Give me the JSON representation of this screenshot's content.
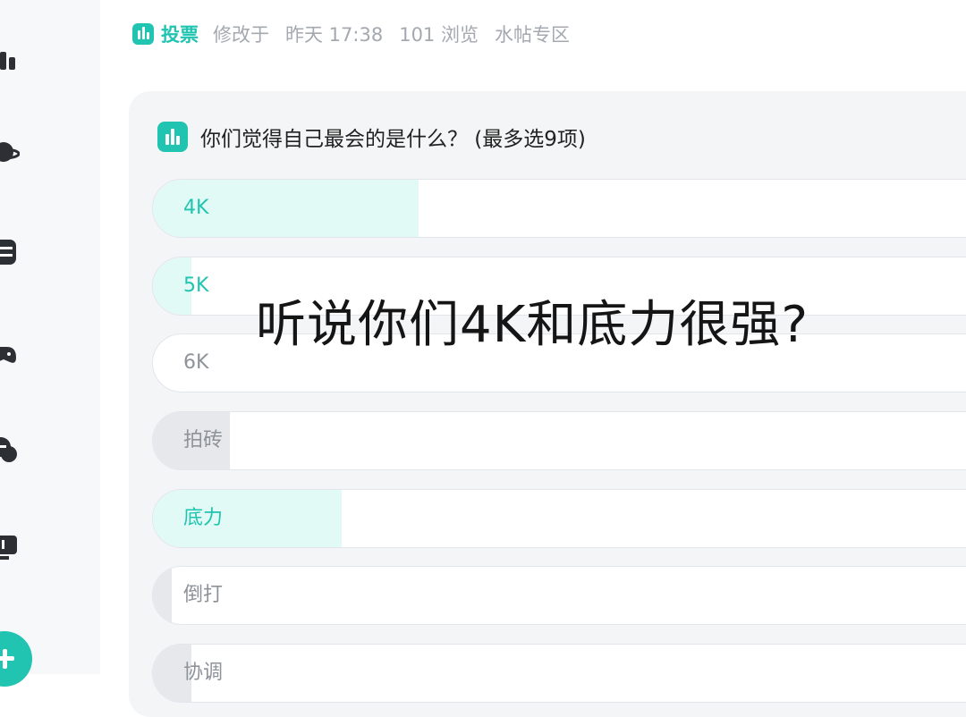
{
  "meta": {
    "tag_label": "投票",
    "modified": "修改于",
    "time": "昨天 17:38",
    "views": "101 浏览",
    "section": "水帖专区"
  },
  "poll": {
    "question": "你们觉得自己最会的是什么？ (最多选9项)",
    "options": [
      {
        "label": "4K",
        "fill_fraction": 0.31,
        "style": "teal",
        "fill_color": "#e1faf6"
      },
      {
        "label": "5K",
        "fill_fraction": 0.045,
        "style": "teal",
        "fill_color": "#e1faf6"
      },
      {
        "label": "6K",
        "fill_fraction": 0.0,
        "style": "gray",
        "fill_color": "#e6e8ec"
      },
      {
        "label": "拍砖",
        "fill_fraction": 0.09,
        "style": "gray",
        "fill_color": "#e6e8ec"
      },
      {
        "label": "底力",
        "fill_fraction": 0.22,
        "style": "teal",
        "fill_color": "#e1faf6"
      },
      {
        "label": "倒打",
        "fill_fraction": 0.022,
        "style": "gray",
        "fill_color": "#e6e8ec"
      },
      {
        "label": "协调",
        "fill_fraction": 0.045,
        "style": "gray",
        "fill_color": "#e6e8ec"
      }
    ]
  },
  "overlay_caption": "听说你们4K和底力很强?",
  "colors": {
    "accent": "#20c4b0",
    "card_bg": "#f4f5f7"
  },
  "sidebar_icons": [
    "chart-icon",
    "planet-icon",
    "notes-icon",
    "gamepad-icon",
    "chat-icon",
    "monitor-icon"
  ]
}
